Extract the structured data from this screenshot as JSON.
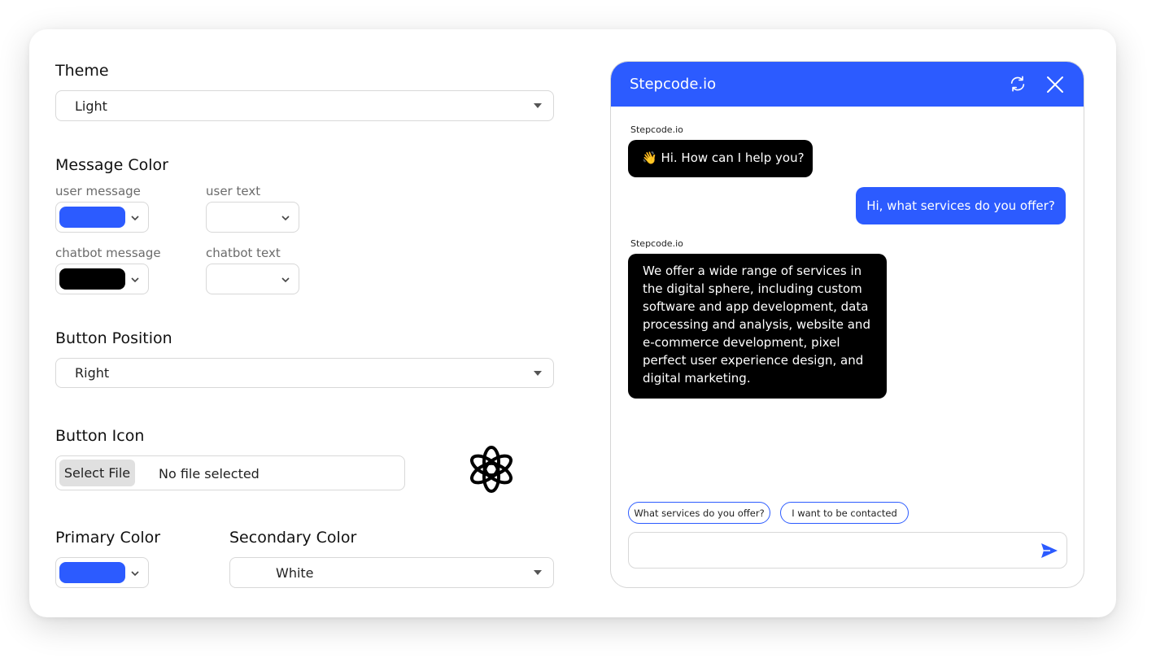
{
  "settings": {
    "theme": {
      "label": "Theme",
      "value": "Light"
    },
    "message_color": {
      "label": "Message Color",
      "user_message": {
        "label": "user message",
        "color": "#2c5bff"
      },
      "user_text": {
        "label": "user text"
      },
      "chatbot_message": {
        "label": "chatbot message",
        "color": "#000000"
      },
      "chatbot_text": {
        "label": "chatbot text"
      }
    },
    "button_position": {
      "label": "Button Position",
      "value": "Right"
    },
    "button_icon": {
      "label": "Button Icon",
      "select_file": "Select File",
      "file_status": "No file selected",
      "preview_icon": "openai-logo-icon"
    },
    "primary_color": {
      "label": "Primary Color",
      "color": "#2c5bff"
    },
    "secondary_color": {
      "label": "Secondary Color",
      "value": "White"
    }
  },
  "chat": {
    "title": "Stepcode.io",
    "header_color": "#2c5bff",
    "icons": {
      "refresh": "refresh-icon",
      "close": "close-icon",
      "send": "send-icon"
    },
    "messages": [
      {
        "from": "bot",
        "sender": "Stepcode.io",
        "text": "👋 Hi. How can I help you?"
      },
      {
        "from": "user",
        "text": "Hi, what services do you offer?"
      },
      {
        "from": "bot",
        "sender": "Stepcode.io",
        "text": "We offer a wide range of services in the digital sphere, including custom software and app development, data processing and analysis, website and e-commerce development, pixel perfect user experience design, and digital marketing."
      }
    ],
    "suggestions": [
      "What services do you offer?",
      "I want to be contacted"
    ],
    "input_value": ""
  }
}
